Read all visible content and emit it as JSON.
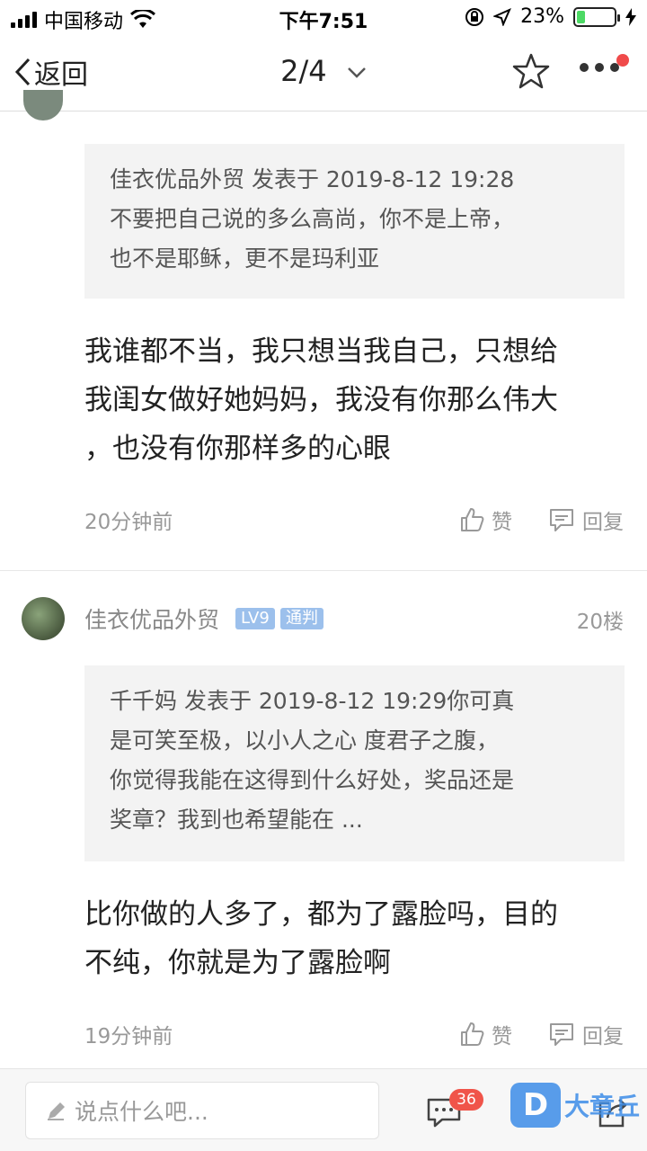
{
  "status_bar": {
    "carrier": "中国移动",
    "time": "下午7:51",
    "battery": "23%",
    "battery_level": 0.23
  },
  "nav": {
    "back_label": "返回",
    "page_indicator": "2/4"
  },
  "posts": [
    {
      "quote": {
        "lines": [
          "佳衣优品外贸 发表于 2019-8-12 19:28",
          "不要把自己说的多么高尚，你不是上帝，",
          "也不是耶稣，更不是玛利亚"
        ]
      },
      "reply_lines": [
        "我谁都不当，我只想当我自己，只想给",
        "我闺女做好她妈妈，我没有你那么伟大",
        "，也没有你那样多的心眼"
      ],
      "time": "20分钟前",
      "like_label": "赞",
      "reply_label": "回复"
    },
    {
      "author": "佳衣优品外贸",
      "level_badge": "LV9",
      "role_badge": "通判",
      "floor": "20楼",
      "quote": {
        "lines": [
          "千千妈 发表于 2019-8-12 19:29你可真",
          "是可笑至极，以小人之心 度君子之腹，",
          "你觉得我能在这得到什么好处，奖品还是",
          "奖章？我到也希望能在 ..."
        ]
      },
      "reply_lines": [
        "比你做的人多了，都为了露脸吗，目的",
        "不纯，你就是为了露脸啊"
      ],
      "time": "19分钟前",
      "like_label": "赞",
      "reply_label": "回复"
    }
  ],
  "bottom_bar": {
    "comment_placeholder": "说点什么吧...",
    "comment_count": "36"
  },
  "watermark": {
    "logo_letter": "D",
    "text": "大章丘"
  },
  "colors": {
    "accent_blue": "#3d8de8",
    "badge_blue": "#9cc0ec",
    "badge_red": "#f0544a",
    "quote_bg": "#f3f3f3"
  }
}
